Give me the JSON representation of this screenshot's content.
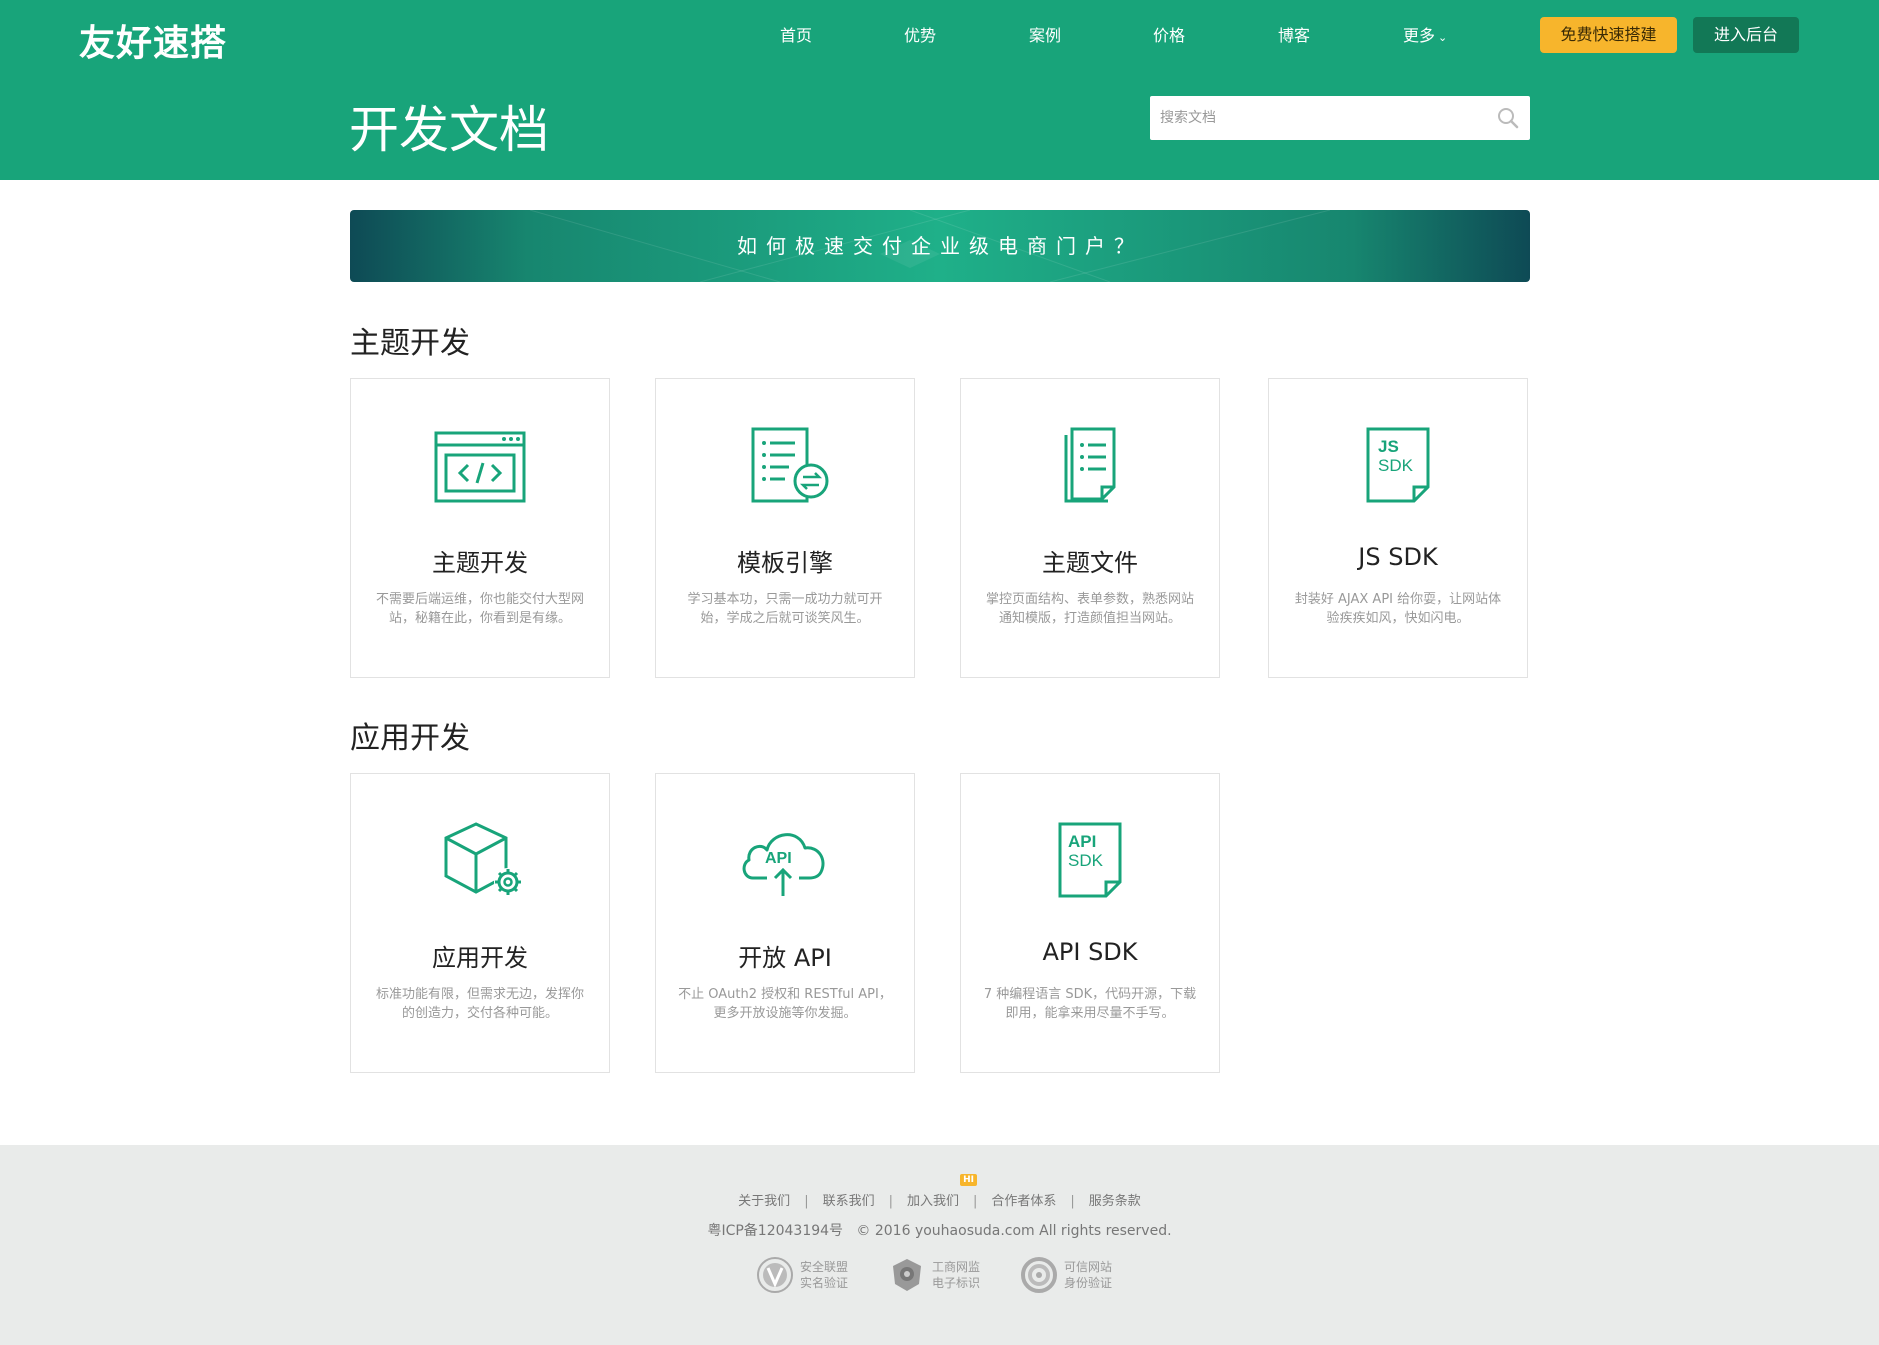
{
  "header": {
    "logo": "友好速搭",
    "nav": [
      {
        "label": "首页"
      },
      {
        "label": "优势"
      },
      {
        "label": "案例"
      },
      {
        "label": "价格"
      },
      {
        "label": "博客"
      },
      {
        "label": "更多"
      }
    ],
    "free_button": "免费快速搭建",
    "admin_button": "进入后台",
    "page_title": "开发文档",
    "search_placeholder": "搜索文档"
  },
  "banner": {
    "text": "如何极速交付企业级电商门户？"
  },
  "sections": [
    {
      "title": "主题开发",
      "cards": [
        {
          "title": "主题开发",
          "desc": "不需要后端运维，你也能交付大型网站，秘籍在此，你看到是有缘。",
          "icon": "code-window-icon"
        },
        {
          "title": "模板引擎",
          "desc": "学习基本功，只需一成功力就可开始，学成之后就可谈笑风生。",
          "icon": "document-sync-icon"
        },
        {
          "title": "主题文件",
          "desc": "掌控页面结构、表单参数，熟悉网站通知模版，打造颜值担当网站。",
          "icon": "documents-stack-icon"
        },
        {
          "title": "JS SDK",
          "desc": "封装好 AJAX API 给你耍，让网站体验疾疾如风，快如闪电。",
          "icon": "js-sdk-file-icon",
          "icon_text": [
            "JS",
            "SDK"
          ]
        }
      ]
    },
    {
      "title": "应用开发",
      "cards": [
        {
          "title": "应用开发",
          "desc": "标准功能有限，但需求无边，发挥你的创造力，交付各种可能。",
          "icon": "cube-gear-icon"
        },
        {
          "title": "开放 API",
          "desc": "不止 OAuth2 授权和 RESTful API，更多开放设施等你发掘。",
          "icon": "cloud-api-icon",
          "icon_text": [
            "API"
          ]
        },
        {
          "title": "API SDK",
          "desc": "7 种编程语言 SDK，代码开源，下载即用，能拿来用尽量不手写。",
          "icon": "api-sdk-file-icon",
          "icon_text": [
            "API",
            "SDK"
          ]
        }
      ]
    }
  ],
  "footer": {
    "links": [
      "关于我们",
      "联系我们",
      "加入我们",
      "合作者体系",
      "服务条款"
    ],
    "hi_badge": "HI",
    "icp": "粤ICP备12043194号",
    "copyright": "© 2016 youhaosuda.com All rights reserved.",
    "badges": [
      {
        "line1": "安全联盟",
        "line2": "实名验证",
        "icon": "v-verified-icon"
      },
      {
        "line1": "工商网监",
        "line2": "电子标识",
        "icon": "shield-emblem-icon"
      },
      {
        "line1": "可信网站",
        "line2": "身份验证",
        "icon": "trusted-site-icon"
      }
    ]
  },
  "colors": {
    "brand": "#18a47a",
    "accent": "#f7b52c",
    "admin": "#127856",
    "icon": "#18a47a"
  }
}
